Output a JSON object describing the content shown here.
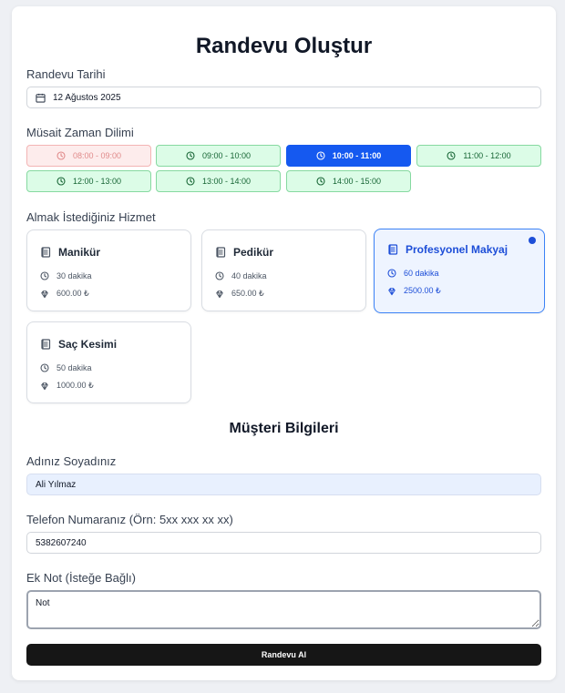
{
  "page_title": "Randevu Oluştur",
  "date": {
    "label": "Randevu Tarihi",
    "value": "12 Ağustos 2025"
  },
  "time": {
    "label": "Müsait Zaman Dilimi",
    "slots": [
      {
        "text": "08:00 - 09:00",
        "state": "unavailable"
      },
      {
        "text": "09:00 - 10:00",
        "state": "available"
      },
      {
        "text": "10:00 - 11:00",
        "state": "selected"
      },
      {
        "text": "11:00 - 12:00",
        "state": "available"
      },
      {
        "text": "12:00 - 13:00",
        "state": "available"
      },
      {
        "text": "13:00 - 14:00",
        "state": "available"
      },
      {
        "text": "14:00 - 15:00",
        "state": "available"
      }
    ]
  },
  "service": {
    "label": "Almak İstediğiniz Hizmet",
    "items": [
      {
        "name": "Manikür",
        "duration": "30 dakika",
        "price": "600.00 ₺",
        "selected": false
      },
      {
        "name": "Pedikür",
        "duration": "40 dakika",
        "price": "650.00 ₺",
        "selected": false
      },
      {
        "name": "Profesyonel Makyaj",
        "duration": "60 dakika",
        "price": "2500.00 ₺",
        "selected": true
      },
      {
        "name": "Saç Kesimi",
        "duration": "50 dakika",
        "price": "1000.00 ₺",
        "selected": false
      }
    ]
  },
  "customer": {
    "title": "Müşteri Bilgileri",
    "name_label": "Adınız Soyadınız",
    "name_value": "Ali Yılmaz",
    "phone_label": "Telefon Numaranız (Örn: 5xx xxx xx xx)",
    "phone_value": "5382607240",
    "note_label": "Ek Not (İsteğe Bağlı)",
    "note_value": "Not"
  },
  "submit_label": "Randevu Al",
  "colors": {
    "accent": "#1559f0",
    "available": "#dcfce7",
    "unavailable": "#fdecec",
    "button": "#161616"
  }
}
